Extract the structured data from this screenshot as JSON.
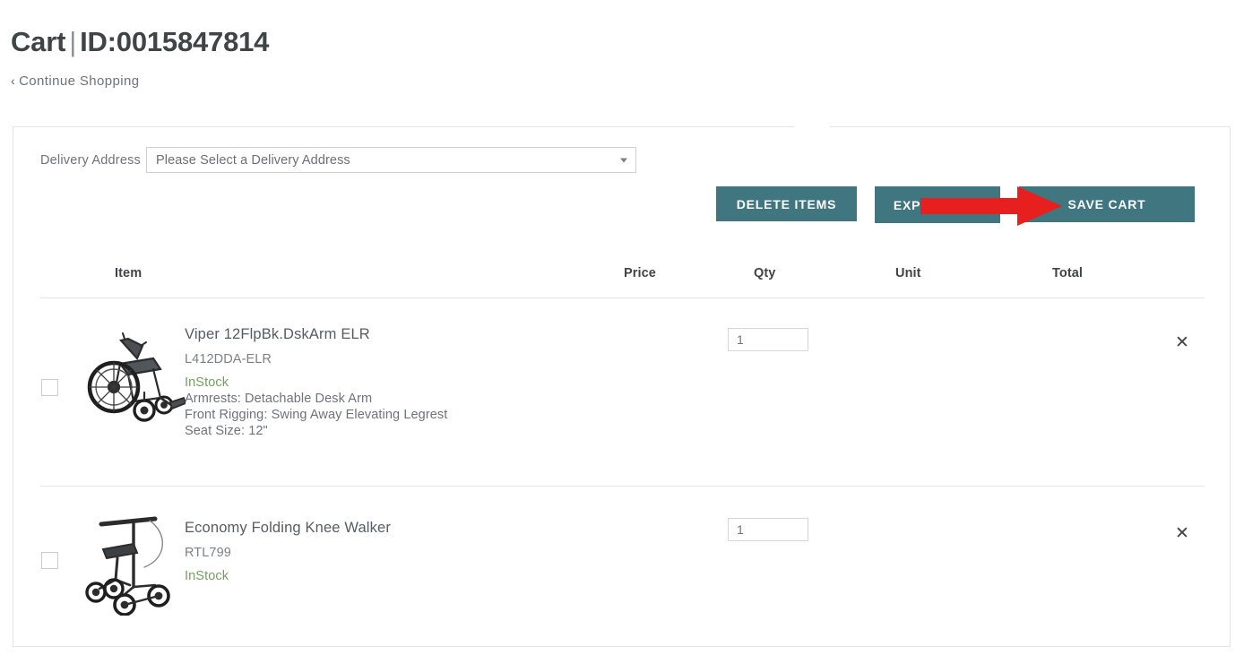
{
  "header": {
    "title_prefix": "Cart",
    "separator": "|",
    "title_id": "ID:0015847814",
    "continue_shopping": "Continue Shopping",
    "chevron": "‹"
  },
  "delivery": {
    "label": "Delivery Address",
    "selected": "Please Select a Delivery Address"
  },
  "actions": {
    "delete_items": "DELETE ITEMS",
    "export_csv": "EXPORT CSV",
    "save_cart": "SAVE CART",
    "button_color": "#3f767f"
  },
  "annotation": {
    "arrow_color": "#e81f1f",
    "points_at": "SAVE CART"
  },
  "table": {
    "columns": [
      "Item",
      "Price",
      "Qty",
      "Unit",
      "Total"
    ],
    "rows": [
      {
        "name": "Viper 12FlpBk.DskArm ELR",
        "sku": "L412DDA-ELR",
        "stock": "InStock",
        "attributes": [
          "Armrests: Detachable Desk Arm",
          "Front Rigging: Swing Away Elevating Legrest",
          "Seat Size: 12\""
        ],
        "price": "",
        "qty": "1",
        "unit": "",
        "total": "",
        "remove": "✕",
        "checked": false,
        "thumb": "wheelchair-image"
      },
      {
        "name": "Economy Folding Knee Walker",
        "sku": "RTL799",
        "stock": "InStock",
        "attributes": [],
        "price": "",
        "qty": "1",
        "unit": "",
        "total": "",
        "remove": "✕",
        "checked": false,
        "thumb": "knee-walker-image"
      }
    ]
  },
  "colors": {
    "stock_green": "#74a05c",
    "text_dark": "#3f4447",
    "text_muted": "#6e7379",
    "border": "#e2e4e6"
  }
}
